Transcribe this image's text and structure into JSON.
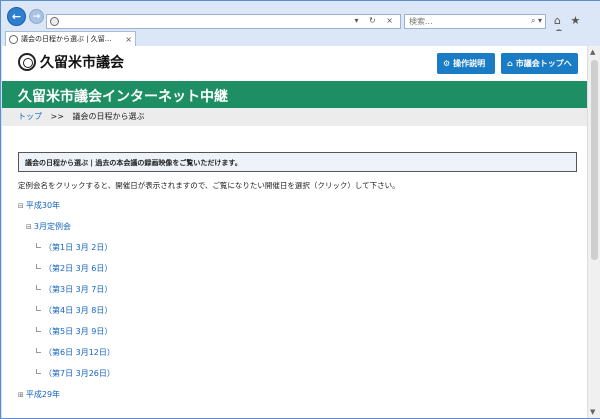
{
  "browser": {
    "address_tools": "▾ ↻ ×",
    "search_placeholder": "検索...",
    "search_tools": "⌕ ▾",
    "chrome_icons": "⌂ ★ ⚙",
    "tab_label": "議会の日程から選ぶ | 久留...",
    "tab_close": "×"
  },
  "site": {
    "logo_text": "久留米市議会",
    "btn_manual": "操作説明",
    "btn_council": "市議会トップへ",
    "banner": "久留米市議会インターネット中継"
  },
  "breadcrumb": {
    "home": "トップ",
    "sep": ">>",
    "current": "議会の日程から選ぶ"
  },
  "notice": "議会の日程から選ぶ | 過去の本会議の録画映像をご覧いただけます。",
  "instruction": "定例会名をクリックすると、開催日が表示されますので、ご覧になりたい開催日を選択（クリック）して下さい。",
  "tree": {
    "year1": "平成30年",
    "session1": "3月定例会",
    "days": [
      "（第1日 3月 2日）",
      "（第2日 3月 6日）",
      "（第3日 3月 7日）",
      "（第4日 3月 8日）",
      "（第5日 3月 9日）",
      "（第6日 3月12日）",
      "（第7日 3月26日）"
    ],
    "year2": "平成29年",
    "toggle_open": "⊟",
    "toggle_closed": "⊞"
  }
}
